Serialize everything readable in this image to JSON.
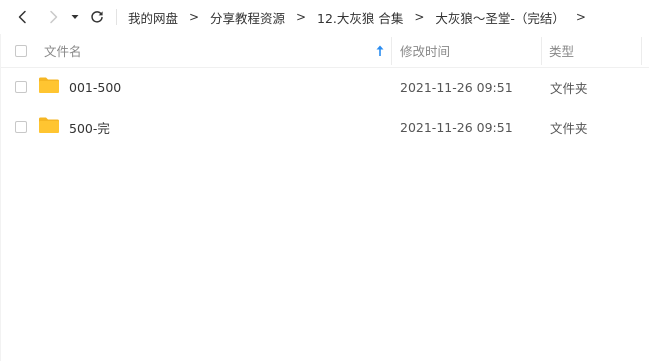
{
  "toolbar": {
    "back_icon": "chevron-left-icon",
    "forward_icon": "chevron-right-icon",
    "history_icon": "caret-down-icon",
    "refresh_icon": "refresh-icon"
  },
  "breadcrumb": {
    "items": [
      "我的网盘",
      "分享教程资源",
      "12.大灰狼 合集",
      "大灰狼～圣堂-（完结）"
    ],
    "separator": ">"
  },
  "table": {
    "columns": {
      "name": "文件名",
      "modified": "修改时间",
      "type": "类型"
    },
    "sort_icon": "arrow-up-icon",
    "rows": [
      {
        "name": "001-500",
        "modified": "2021-11-26 09:51",
        "type": "文件夹",
        "icon": "folder-icon"
      },
      {
        "name": "500-完",
        "modified": "2021-11-26 09:51",
        "type": "文件夹",
        "icon": "folder-icon"
      }
    ]
  },
  "colors": {
    "folder": "#FFC531",
    "folder_back": "#F5B623",
    "sort_arrow": "#2A8CF0",
    "nav_disabled": "#C9C9C9",
    "nav_active": "#333333"
  }
}
